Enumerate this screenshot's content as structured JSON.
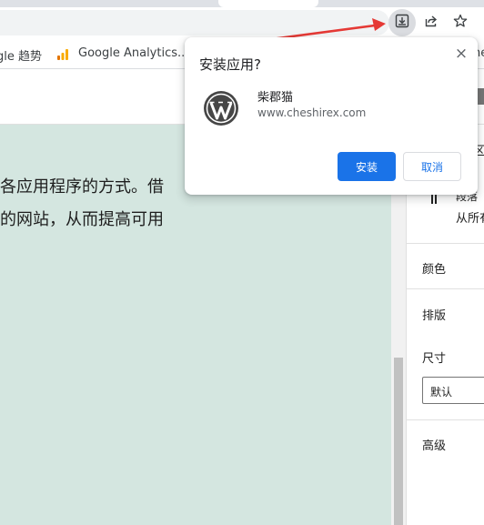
{
  "bookmarks_bar": {
    "items": [
      {
        "label": "gle 趋势",
        "icon": "google-trends-icon"
      },
      {
        "label": "Google Analytics...",
        "icon": "analytics-icon"
      },
      {
        "label": "he",
        "icon": ""
      }
    ]
  },
  "install_dialog": {
    "title": "安装应用?",
    "app_name": "柴郡猫",
    "app_url": "www.cheshirex.com",
    "install_label": "安装",
    "cancel_label": "取消",
    "close_icon": "×"
  },
  "editor": {
    "paragraph_lines": [
      "各应用程序的方式。借",
      "的网站，从而提高可用"
    ]
  },
  "sidebar": {
    "tab_fragment": "区",
    "style_fragment": "段落",
    "style_desc": "从所有",
    "color_label": "颜色",
    "typography_label": "排版",
    "size_label": "尺寸",
    "size_value": "默认",
    "advanced_label": "高级"
  },
  "colors": {
    "primary_button": "#1a73e8",
    "canvas_background": "#d4e6e0",
    "annotation_arrow": "#e53935"
  }
}
